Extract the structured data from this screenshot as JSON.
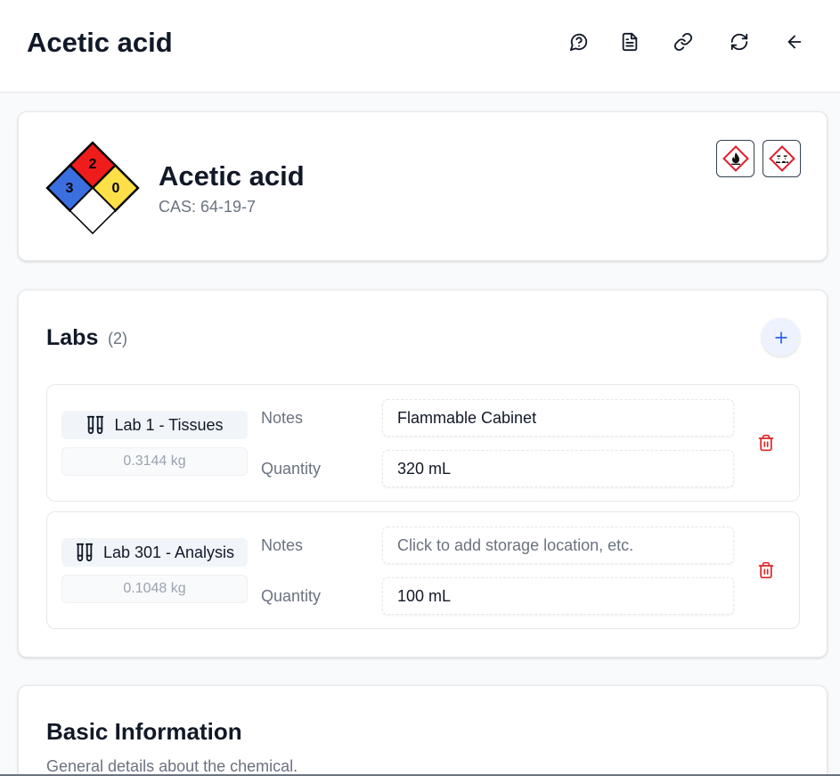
{
  "header": {
    "title": "Acetic acid",
    "actions": [
      {
        "name": "help",
        "icon": "message-circle-question-icon"
      },
      {
        "name": "document",
        "icon": "file-text-icon"
      },
      {
        "name": "link",
        "icon": "link-icon"
      },
      {
        "name": "refresh",
        "icon": "refresh-icon"
      },
      {
        "name": "back",
        "icon": "arrow-left-icon"
      }
    ]
  },
  "chemical": {
    "name": "Acetic acid",
    "cas": "CAS: 64-19-7",
    "nfpa": {
      "health": "3",
      "flammability": "2",
      "instability": "0",
      "special": "",
      "colors": {
        "health": "#3b6fe0",
        "flammability": "#ef1c1c",
        "instability": "#fde047",
        "special": "#ffffff"
      }
    },
    "ghs_pictograms": [
      "flame-pictogram-icon",
      "corrosion-pictogram-icon"
    ]
  },
  "labs": {
    "title": "Labs",
    "count": "(2)",
    "add_icon": "plus-icon",
    "notes_label": "Notes",
    "quantity_label": "Quantity",
    "items": [
      {
        "name": "Lab 1 - Tissues",
        "mass": "0.3144 kg",
        "notes": "Flammable Cabinet",
        "notes_placeholder": "",
        "quantity": "320 mL"
      },
      {
        "name": "Lab 301 - Analysis",
        "mass": "0.1048 kg",
        "notes": "",
        "notes_placeholder": "Click to add storage location, etc.",
        "quantity": "100 mL"
      }
    ]
  },
  "basic": {
    "title": "Basic Information",
    "subtitle": "General details about the chemical."
  },
  "colors": {
    "accent": "#2563eb",
    "danger": "#dc2626",
    "text": "#111827",
    "muted": "#6b7280"
  }
}
